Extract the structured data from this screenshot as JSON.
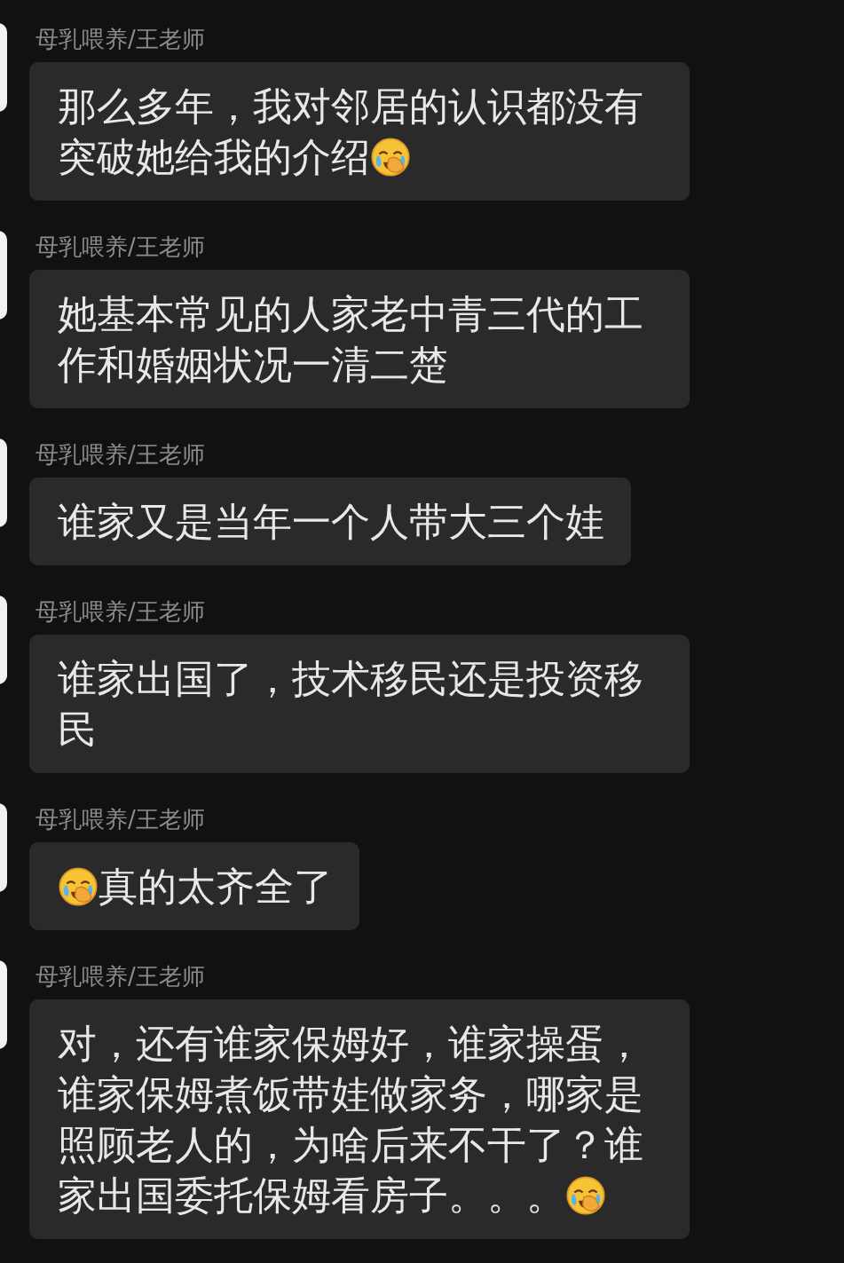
{
  "messages": [
    {
      "sender": "母乳喂养/王老师",
      "parts": [
        {
          "kind": "text",
          "text": "那么多年，我对邻居的认识都没有突破她给我的介绍"
        },
        {
          "kind": "emoji"
        }
      ]
    },
    {
      "sender": "母乳喂养/王老师",
      "parts": [
        {
          "kind": "text",
          "text": "她基本常见的人家老中青三代的工作和婚姻状况一清二楚"
        }
      ]
    },
    {
      "sender": "母乳喂养/王老师",
      "parts": [
        {
          "kind": "text",
          "text": "谁家又是当年一个人带大三个娃"
        }
      ]
    },
    {
      "sender": "母乳喂养/王老师",
      "parts": [
        {
          "kind": "text",
          "text": "谁家出国了，技术移民还是投资移民"
        }
      ]
    },
    {
      "sender": "母乳喂养/王老师",
      "parts": [
        {
          "kind": "emoji"
        },
        {
          "kind": "text",
          "text": "真的太齐全了"
        }
      ]
    },
    {
      "sender": "母乳喂养/王老师",
      "parts": [
        {
          "kind": "text",
          "text": "对，还有谁家保姆好，谁家操蛋，谁家保姆煮饭带娃做家务，哪家是照顾老人的，为啥后来不干了？谁家出国委托保姆看房子。。。"
        },
        {
          "kind": "emoji"
        }
      ]
    }
  ]
}
